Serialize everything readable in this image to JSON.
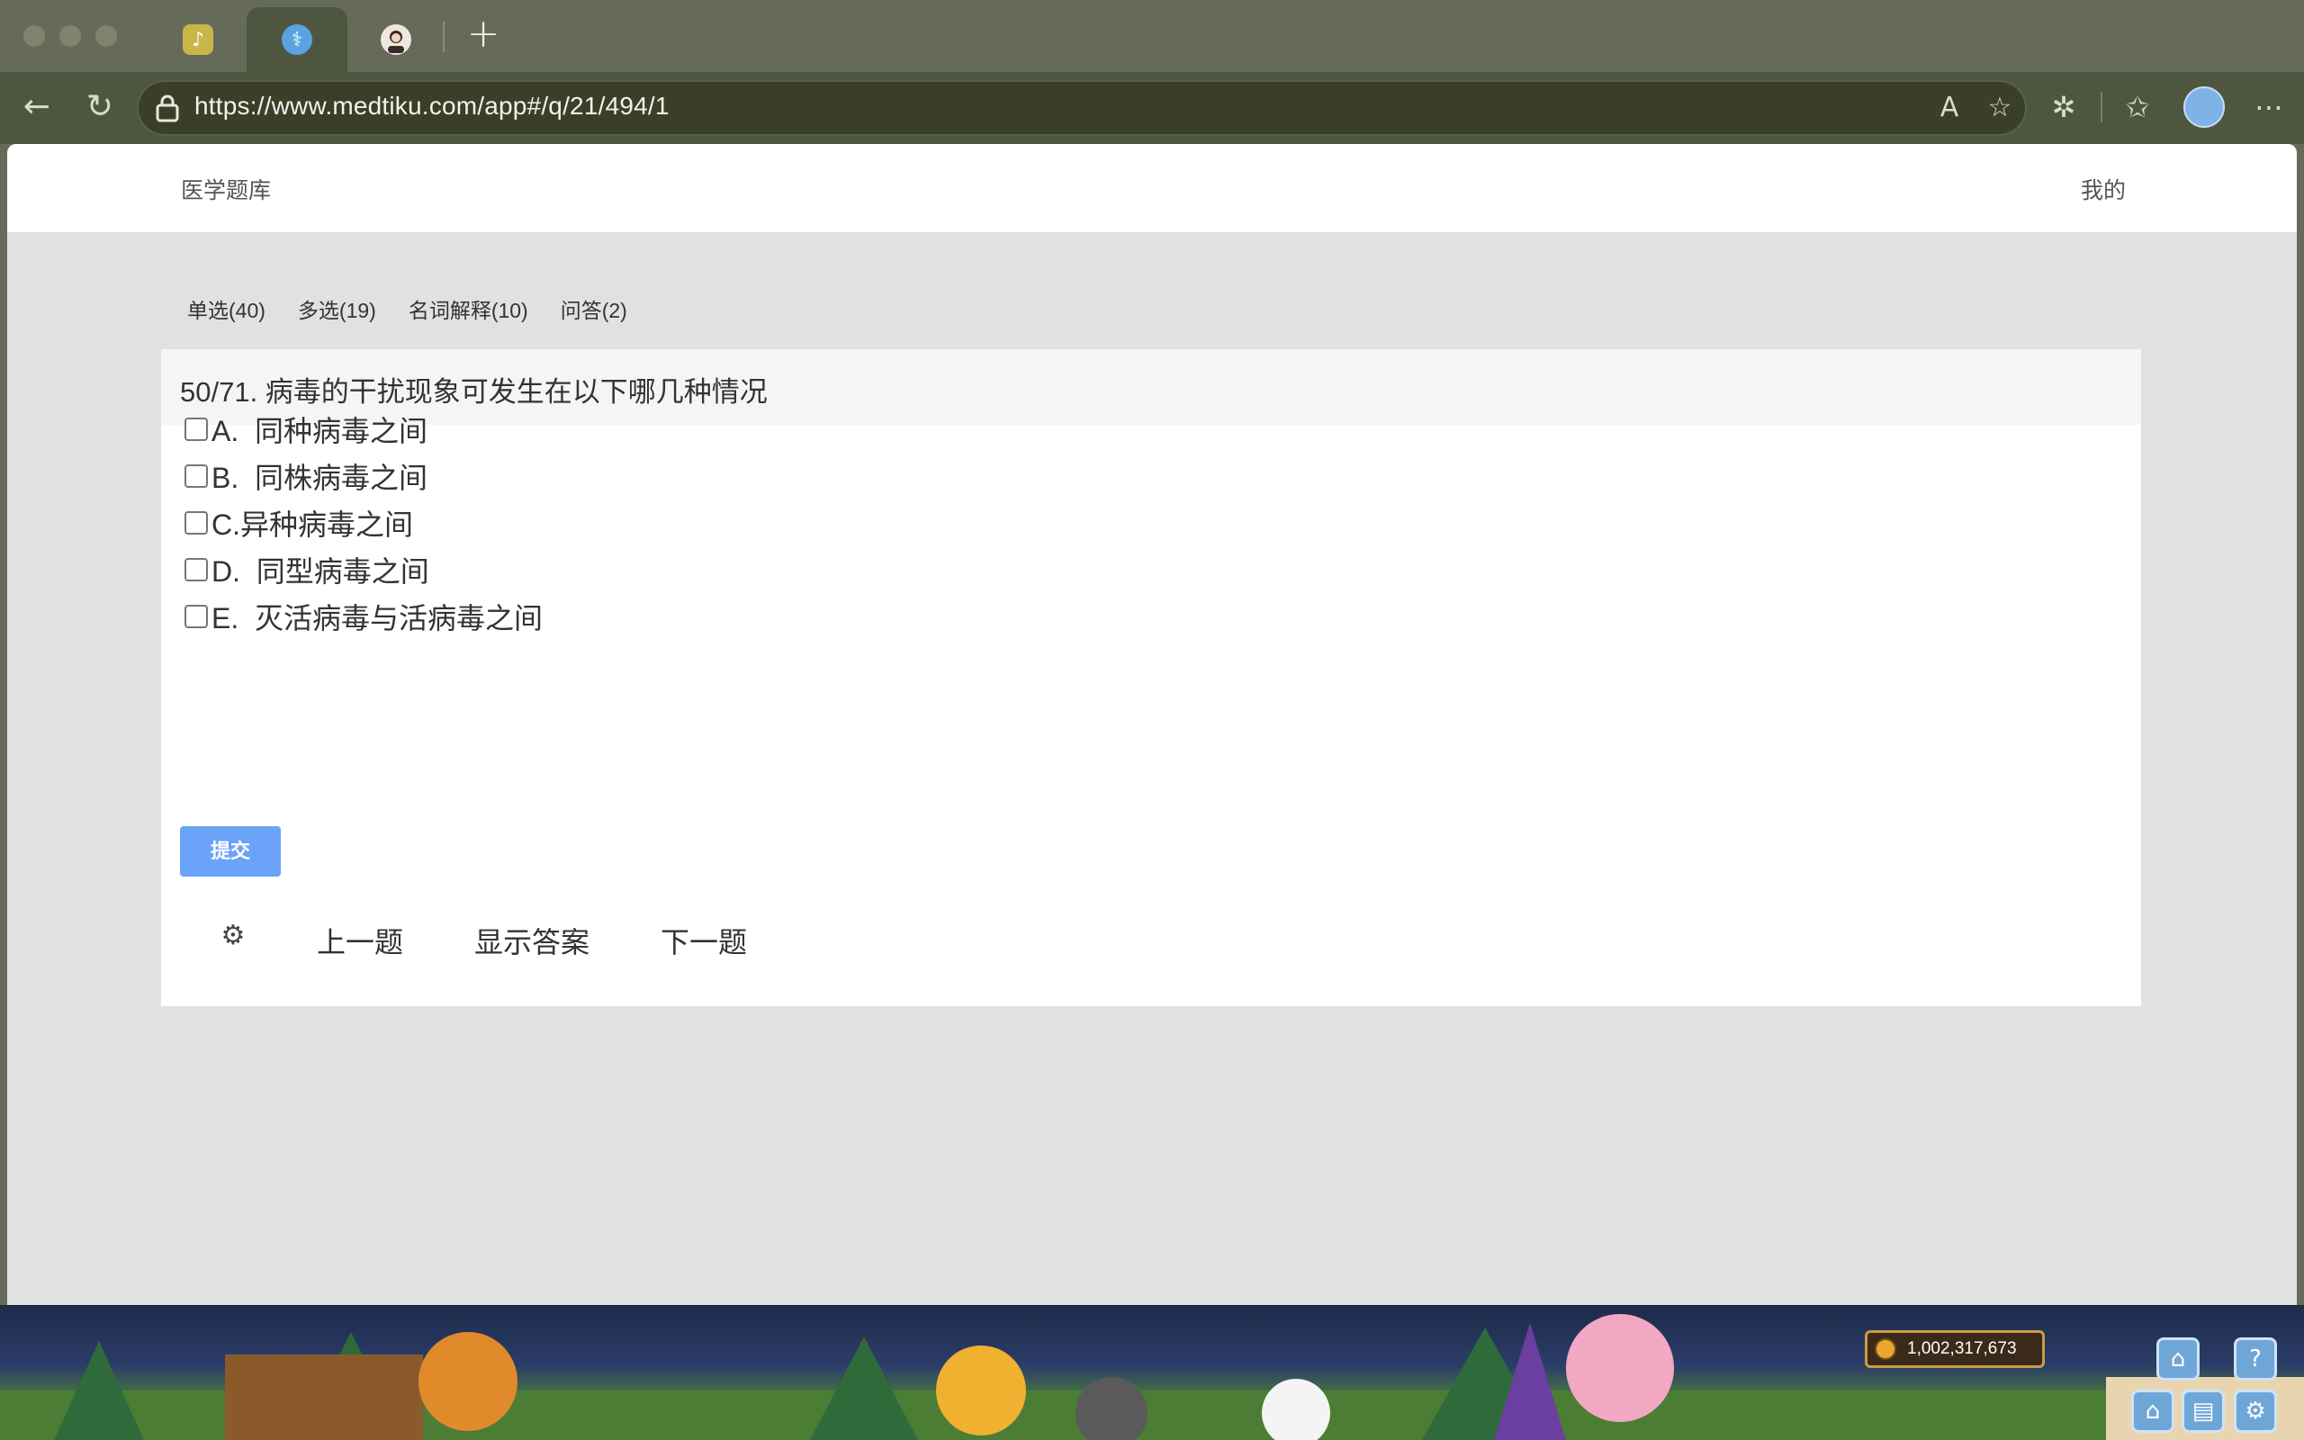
{
  "browser": {
    "tabs": [
      {
        "name": "tab-1",
        "icon": "notes-icon"
      },
      {
        "name": "tab-2",
        "icon": "medtiku-icon",
        "active": true
      },
      {
        "name": "tab-3",
        "icon": "avatar-icon"
      }
    ],
    "url": "https://www.medtiku.com/app#/q/21/494/1"
  },
  "site": {
    "brand": "医学题库",
    "account": "我的"
  },
  "question_tabs": [
    {
      "label": "单选(40)"
    },
    {
      "label": "多选(19)"
    },
    {
      "label": "名词解释(10)"
    },
    {
      "label": "问答(2)"
    }
  ],
  "question": {
    "title": "50/71. 病毒的干扰现象可发生在以下哪几种情况",
    "options": [
      {
        "text": "A.  同种病毒之间",
        "checked": false
      },
      {
        "text": "B.  同株病毒之间",
        "checked": false
      },
      {
        "text": "C.异种病毒之间",
        "checked": false
      },
      {
        "text": "D.  同型病毒之间",
        "checked": false
      },
      {
        "text": "E.  灭活病毒与活病毒之间",
        "checked": false
      }
    ],
    "submit_label": "提交"
  },
  "navigation": {
    "settings_icon": "gear-icon",
    "prev_label": "上一题",
    "show_answer_label": "显示答案",
    "next_label": "下一题"
  },
  "game_bar": {
    "coins": "1,002,317,673"
  },
  "colors": {
    "accent": "#6aa3f7",
    "chrome": "#4f5640",
    "page_bg": "#e1e1e1"
  }
}
